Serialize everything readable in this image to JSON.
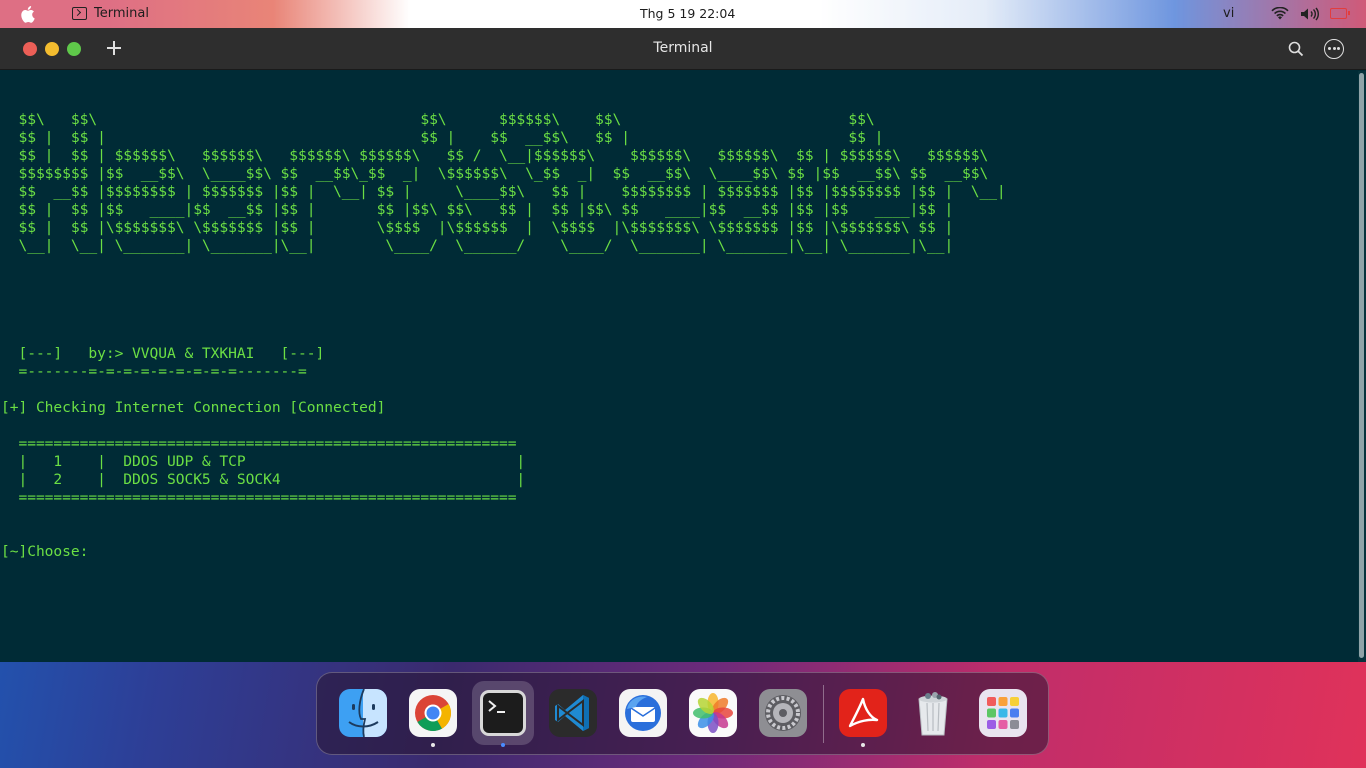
{
  "menubar": {
    "app_name": "Terminal",
    "clock": "Thg 5 19  22:04",
    "input_lang": "vi"
  },
  "window": {
    "title": "Terminal"
  },
  "terminal": {
    "lines": [
      "  $$\\   $$\\                                     $$\\      $$$$$$\\    $$\\                          $$\\",
      "  $$ |  $$ |                                    $$ |    $$  __$$\\   $$ |                         $$ |",
      "  $$ |  $$ | $$$$$$\\   $$$$$$\\   $$$$$$\\ $$$$$$\\   $$ /  \\__|$$$$$$\\    $$$$$$\\   $$$$$$\\  $$ | $$$$$$\\   $$$$$$\\",
      "  $$$$$$$$ |$$  __$$\\  \\____$$\\ $$  __$$\\_$$  _|  \\$$$$$$\\  \\_$$  _|  $$  __$$\\  \\____$$\\ $$ |$$  __$$\\ $$  __$$\\",
      "  $$  __$$ |$$$$$$$$ | $$$$$$$ |$$ |  \\__| $$ |     \\____$$\\   $$ |    $$$$$$$$ | $$$$$$$ |$$ |$$$$$$$$ |$$ |  \\__|",
      "  $$ |  $$ |$$   ____|$$  __$$ |$$ |       $$ |$$\\ $$\\   $$ |  $$ |$$\\ $$   ____|$$  __$$ |$$ |$$   ____|$$ |",
      "  $$ |  $$ |\\$$$$$$$\\ \\$$$$$$$ |$$ |       \\$$$$  |\\$$$$$$  |  \\$$$$  |\\$$$$$$$\\ \\$$$$$$$ |$$ |\\$$$$$$$\\ $$ |",
      "  \\__|  \\__| \\_______| \\_______|\\__|        \\____/  \\______/    \\____/  \\_______| \\_______|\\__| \\_______|\\__|",
      "",
      "",
      "",
      "",
      "",
      "  [---]   by:> VVQUA & TXKHAI   [---]",
      "  =-------=-=-=-=-=-=-=-=-=-------=",
      "",
      "[+] Checking Internet Connection [Connected]",
      "",
      "  =========================================================",
      "  |   1    |  DDOS UDP & TCP                               |",
      "  |   2    |  DDOS SOCK5 & SOCK4                           |",
      "  =========================================================",
      "",
      "",
      "[~]Choose: "
    ]
  },
  "dock": {
    "apps": [
      "finder-icon",
      "chrome-icon",
      "terminal-icon",
      "vscode-icon",
      "thunderbird-icon",
      "photos-icon",
      "settings-icon",
      "acrobat-icon",
      "trash-icon",
      "launchpad-icon"
    ]
  },
  "colors": {
    "terminal_bg": "#002b36",
    "terminal_fg": "#6bdf44",
    "titlebar_bg": "#2e2e2e"
  }
}
